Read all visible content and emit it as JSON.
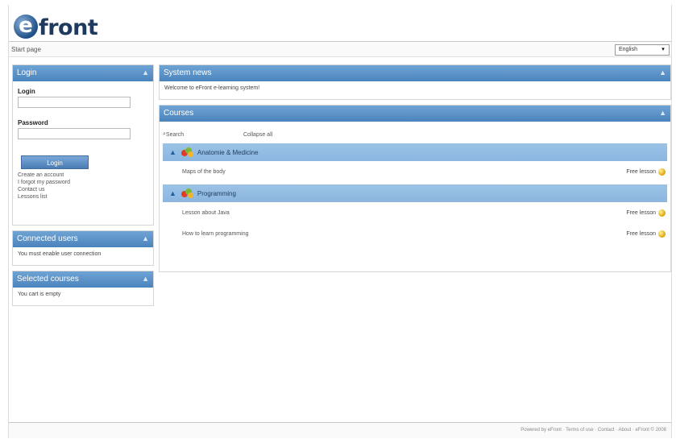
{
  "app": {
    "logo_letter": "e",
    "logo_text": "front",
    "path": "Start page"
  },
  "language": {
    "selected": "English"
  },
  "login": {
    "title": "Login",
    "login_label": "Login",
    "password_label": "Password",
    "button": "Login",
    "links": [
      "Create an account",
      "I forgot my password",
      "Contact us",
      "Lessons list"
    ]
  },
  "connected_users": {
    "title": "Connected users",
    "text": "You must enable user connection"
  },
  "selected_courses": {
    "title": "Selected courses",
    "text": "You cart is empty"
  },
  "system_news": {
    "title": "System news",
    "text": "Welcome to eFront e-learning system!"
  },
  "courses": {
    "title": "Courses",
    "search_placeholder": "Search",
    "collapse_all": "Collapse all",
    "categories": [
      {
        "name": "Anatomie & Medicine",
        "courses": [
          {
            "name": "Maps of the body",
            "action": "Free lesson"
          }
        ]
      },
      {
        "name": "Programming",
        "courses": [
          {
            "name": "Lesson about Java",
            "action": "Free lesson"
          },
          {
            "name": "How to learn programming",
            "action": "Free lesson"
          }
        ]
      }
    ]
  },
  "footer": {
    "text": "Powered by eFront · Terms of use · Contact · About · eFront © 2008"
  },
  "colors": {
    "header_blue": "#4a84bd",
    "category_blue": "#8bb6df",
    "logo_navy": "#1f3a5f"
  }
}
